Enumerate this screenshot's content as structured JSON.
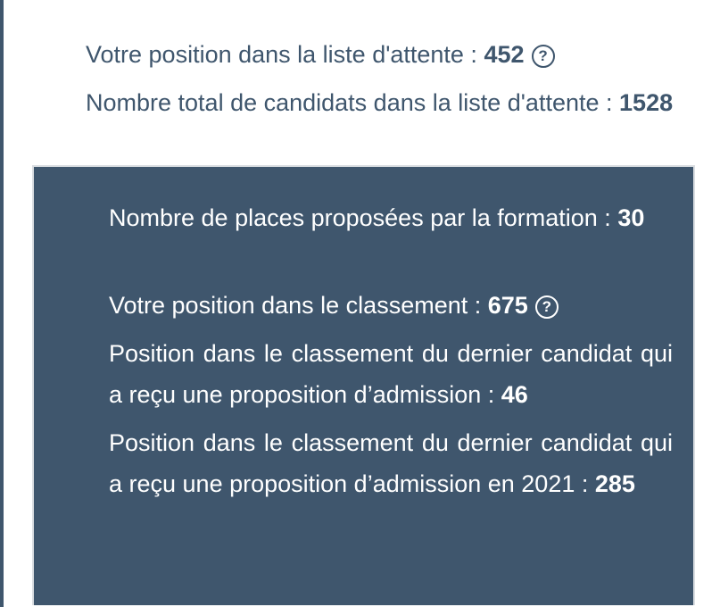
{
  "waitlist": {
    "position_label": "Votre position dans la liste d'attente :",
    "position_value": "452",
    "total_label": "Nombre total de candidats dans la liste d'attente :",
    "total_value": "1528"
  },
  "panel": {
    "places_label": "Nombre de places proposées par la formation :",
    "places_value": "30",
    "ranking_label": "Votre position dans le classement :",
    "ranking_value": "675",
    "last_admitted_label": "Position dans le classement du dernier candidat qui a reçu une proposition d’admission :",
    "last_admitted_value": "46",
    "last_admitted_prev_label": "Position dans le classement du dernier candidat qui a reçu une proposition d’admission en 2021 :",
    "last_admitted_prev_value": "285"
  },
  "icons": {
    "help_glyph": "?"
  },
  "colors": {
    "text": "#3f566d",
    "panel_background": "#3f566d",
    "panel_text": "#ffffff",
    "panel_border": "#d9dde1"
  }
}
